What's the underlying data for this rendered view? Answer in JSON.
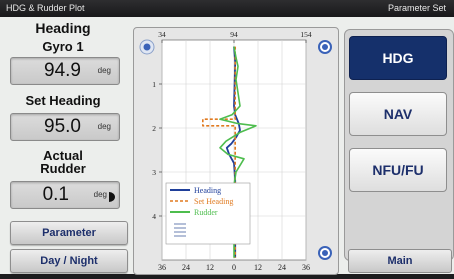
{
  "titlebar": {
    "left": "HDG & Rudder Plot",
    "right": "Parameter Set"
  },
  "left": {
    "heading_title": "Heading",
    "gyro_label": "Gyro 1",
    "gyro_value": "94.9",
    "gyro_unit": "deg",
    "set_heading_label": "Set Heading",
    "set_heading_value": "95.0",
    "set_heading_unit": "deg",
    "actual_rudder_label_1": "Actual",
    "actual_rudder_label_2": "Rudder",
    "rudder_value": "0.1",
    "rudder_unit": "deg",
    "parameter_button": "Parameter",
    "day_night_button": "Day / Night"
  },
  "right": {
    "hdg": "HDG",
    "nav": "NAV",
    "nfu": "NFU/FU",
    "main": "Main"
  },
  "colors": {
    "heading": "#1f3f9a",
    "set_heading": "#e07a20",
    "rudder": "#4ebd4e",
    "active": "#15306b"
  },
  "chart_data": {
    "type": "line",
    "top_axis": {
      "ticks": [
        "34",
        "94",
        "154"
      ],
      "range": [
        34,
        154
      ]
    },
    "bottom_axis": {
      "ticks": [
        "36",
        "24",
        "12",
        "0",
        "12",
        "24",
        "36"
      ],
      "range": [
        -36,
        36
      ]
    },
    "y_axis": {
      "ticks": [
        "1",
        "2",
        "3",
        "4"
      ],
      "range": [
        0,
        5
      ]
    },
    "legend": {
      "placement": "bottom-left"
    },
    "series": [
      {
        "name": "Heading",
        "axis": "top",
        "color": "#1f3f9a",
        "points": [
          [
            94,
            0.15
          ],
          [
            95,
            0.5
          ],
          [
            94.5,
            1.0
          ],
          [
            94,
            1.5
          ],
          [
            95,
            1.7
          ],
          [
            98,
            1.9
          ],
          [
            99,
            2.05
          ],
          [
            96,
            2.2
          ],
          [
            92,
            2.35
          ],
          [
            88,
            2.45
          ],
          [
            90,
            2.6
          ],
          [
            94,
            2.8
          ],
          [
            95,
            3.2
          ],
          [
            95,
            3.6
          ],
          [
            95,
            4.0
          ],
          [
            95,
            4.5
          ],
          [
            95,
            4.95
          ]
        ]
      },
      {
        "name": "Set Heading",
        "axis": "top",
        "color": "#e07a20",
        "points": [
          [
            95,
            0.15
          ],
          [
            95,
            1.8
          ],
          [
            68,
            1.8
          ],
          [
            68,
            1.95
          ],
          [
            95,
            1.95
          ],
          [
            95,
            4.95
          ]
        ]
      },
      {
        "name": "Rudder",
        "axis": "bottom",
        "color": "#4ebd4e",
        "points": [
          [
            0,
            0.15
          ],
          [
            1,
            0.4
          ],
          [
            2,
            0.6
          ],
          [
            1,
            0.9
          ],
          [
            2,
            1.2
          ],
          [
            3,
            1.5
          ],
          [
            -1,
            1.7
          ],
          [
            -7,
            1.8
          ],
          [
            2,
            1.9
          ],
          [
            11,
            1.95
          ],
          [
            3,
            2.1
          ],
          [
            -4,
            2.3
          ],
          [
            -7,
            2.45
          ],
          [
            -3,
            2.6
          ],
          [
            5,
            2.7
          ],
          [
            3,
            2.85
          ],
          [
            1,
            3.0
          ],
          [
            0,
            3.3
          ],
          [
            0,
            4.95
          ]
        ]
      }
    ]
  }
}
